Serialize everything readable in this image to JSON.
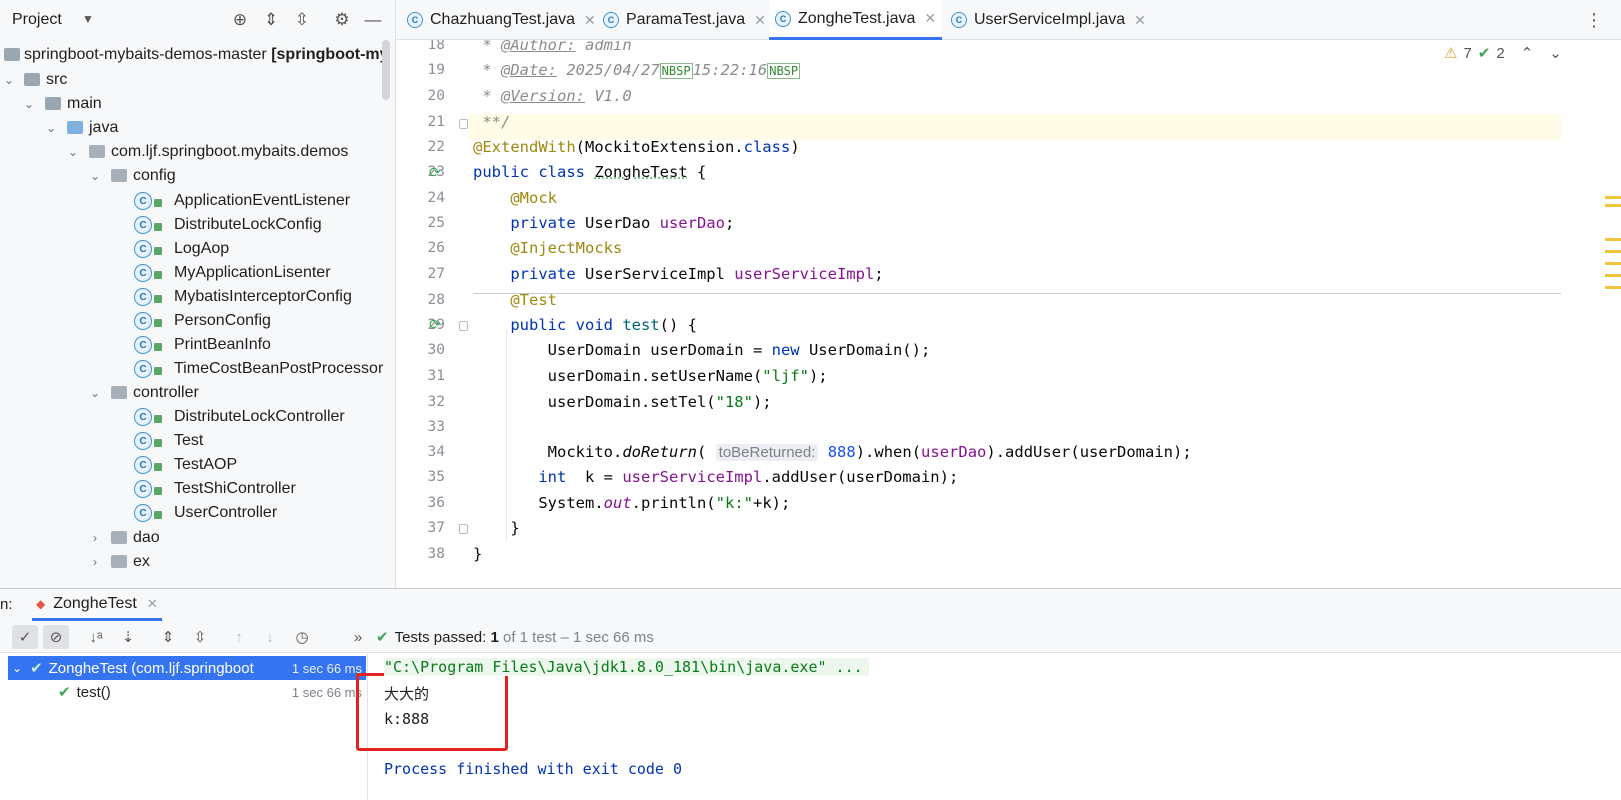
{
  "project_panel": {
    "title": "Project",
    "root_label": "springboot-mybaits-demos-master",
    "root_module": "[springboot-my",
    "tree": [
      {
        "label": "src",
        "kind": "folder"
      },
      {
        "label": "main",
        "kind": "folder"
      },
      {
        "label": "java",
        "kind": "source-folder"
      },
      {
        "label": "com.ljf.springboot.mybaits.demos",
        "kind": "package"
      },
      {
        "label": "config",
        "kind": "package"
      },
      {
        "label": "ApplicationEventListener",
        "kind": "class"
      },
      {
        "label": "DistributeLockConfig",
        "kind": "class"
      },
      {
        "label": "LogAop",
        "kind": "class"
      },
      {
        "label": "MyApplicationLisenter",
        "kind": "class"
      },
      {
        "label": "MybatisInterceptorConfig",
        "kind": "class"
      },
      {
        "label": "PersonConfig",
        "kind": "class"
      },
      {
        "label": "PrintBeanInfo",
        "kind": "class"
      },
      {
        "label": "TimeCostBeanPostProcessor",
        "kind": "class"
      },
      {
        "label": "controller",
        "kind": "package"
      },
      {
        "label": "DistributeLockController",
        "kind": "class"
      },
      {
        "label": "Test",
        "kind": "class"
      },
      {
        "label": "TestAOP",
        "kind": "class"
      },
      {
        "label": "TestShiController",
        "kind": "class"
      },
      {
        "label": "UserController",
        "kind": "class"
      },
      {
        "label": "dao",
        "kind": "package"
      },
      {
        "label": "ex",
        "kind": "package"
      }
    ]
  },
  "editor": {
    "tabs": [
      {
        "label": "ChazhuangTest.java"
      },
      {
        "label": "ParamaTest.java"
      },
      {
        "label": "ZongheTest.java",
        "active": true
      },
      {
        "label": "UserServiceImpl.java"
      }
    ],
    "inspection": {
      "warnings": "7",
      "weak_warnings": "2"
    },
    "line_numbers": [
      "18",
      "19",
      "20",
      "21",
      "22",
      "23",
      "24",
      "25",
      "26",
      "27",
      "28",
      "29",
      "30",
      "31",
      "32",
      "33",
      "34",
      "35",
      "36",
      "37",
      "38"
    ],
    "code": {
      "l18_prefix": " * ",
      "l18_tag": "@Author:",
      "l18_val": " admin",
      "l19_prefix": " * ",
      "l19_tag": "@Date:",
      "l19_val": " 2025/04/27",
      "l19_nbsp1": "NBSP",
      "l19_time": "15:22:16",
      "l19_nbsp2": "NBSP",
      "l20_prefix": " * ",
      "l20_tag": "@Version:",
      "l20_val": " V1.0",
      "l21": " **/",
      "l22_ann": "@ExtendWith",
      "l22_mid": "(MockitoExtension.",
      "l22_kw": "class",
      "l22_end": ")",
      "l23_kw": "public class ",
      "l23_name": "ZongheTest",
      "l23_end": " {",
      "l24_ann": "@Mock",
      "l25_kw": "private ",
      "l25_type": "UserDao ",
      "l25_fld": "userDao",
      "l25_end": ";",
      "l26_ann": "@InjectMocks",
      "l27_kw": "private ",
      "l27_type": "UserServiceImpl ",
      "l27_fld": "userServiceImpl",
      "l27_end": ";",
      "l28_ann": "@Test",
      "l29_kw": "public void ",
      "l29_name": "test",
      "l29_end": "() {",
      "l30_a": "UserDomain userDomain = ",
      "l30_kw": "new",
      "l30_b": " UserDomain();",
      "l31_a": "userDomain.setUserName(",
      "l31_str": "\"ljf\"",
      "l31_b": ");",
      "l32_a": "userDomain.setTel(",
      "l32_str": "\"18\"",
      "l32_b": ");",
      "l34_a": "Mockito.",
      "l34_m": "doReturn",
      "l34_p": "(",
      "l34_hint": "toBeReturned:",
      "l34_num": " 888",
      "l34_b": ").when(",
      "l34_fld": "userDao",
      "l34_c": ").addUser(userDomain);",
      "l35_kw": "int",
      "l35_a": "  k = ",
      "l35_fld": "userServiceImpl",
      "l35_b": ".addUser(userDomain);",
      "l36_a": "System.",
      "l36_out": "out",
      "l36_b": ".println(",
      "l36_str": "\"k:\"",
      "l36_c": "+k);",
      "l37": "}",
      "l38": "}"
    }
  },
  "run_window": {
    "label": "n:",
    "tab_label": "ZongheTest",
    "status_main": "Tests passed: ",
    "status_count": "1",
    "status_sub": " of 1 test – 1 sec 66 ms",
    "tests": [
      {
        "label": "ZongheTest (com.ljf.springboot",
        "time": "1 sec 66 ms"
      },
      {
        "label": "test()",
        "time": "1 sec 66 ms"
      }
    ],
    "console": {
      "command": "\"C:\\Program Files\\Java\\jdk1.8.0_181\\bin\\java.exe\" ...",
      "out1": "大大的",
      "out2": "k:888",
      "exit": "Process finished with exit code 0"
    }
  },
  "colors": {
    "accent": "#3574f0",
    "pass": "#3fa356",
    "highlight_box": "#e52222"
  }
}
